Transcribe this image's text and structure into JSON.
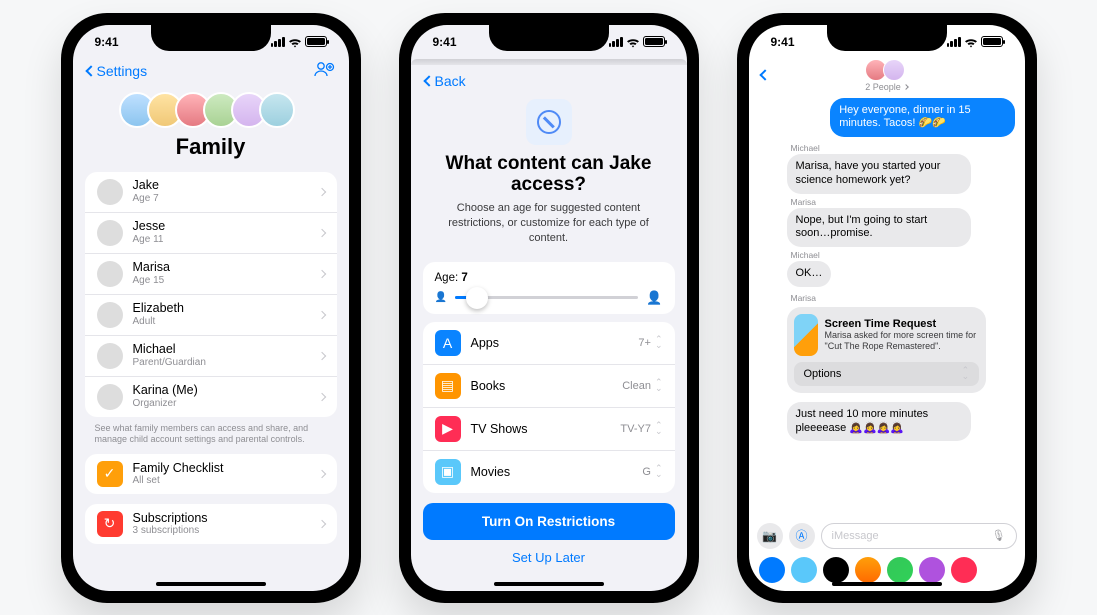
{
  "status": {
    "time": "9:41"
  },
  "phone1": {
    "back": "Settings",
    "title": "Family",
    "members": [
      {
        "name": "Jake",
        "sub": "Age 7",
        "av": "c0"
      },
      {
        "name": "Jesse",
        "sub": "Age 11",
        "av": "c1"
      },
      {
        "name": "Marisa",
        "sub": "Age 15",
        "av": "c2"
      },
      {
        "name": "Elizabeth",
        "sub": "Adult",
        "av": "c3"
      },
      {
        "name": "Michael",
        "sub": "Parent/Guardian",
        "av": "c4"
      },
      {
        "name": "Karina (Me)",
        "sub": "Organizer",
        "av": "c2"
      }
    ],
    "note": "See what family members can access and share, and manage child account settings and parental controls.",
    "checklist": {
      "title": "Family Checklist",
      "sub": "All set"
    },
    "subs": {
      "title": "Subscriptions",
      "sub": "3 subscriptions"
    }
  },
  "phone2": {
    "back": "Back",
    "title": "What content can Jake access?",
    "subtitle": "Choose an age for suggested content restrictions, or customize for each type of content.",
    "age_label": "Age:",
    "age_value": "7",
    "slider_pct": 12,
    "rows": [
      {
        "icon": "blue",
        "label": "Apps",
        "value": "7+"
      },
      {
        "icon": "book",
        "label": "Books",
        "value": "Clean"
      },
      {
        "icon": "pink",
        "label": "TV Shows",
        "value": "TV-Y7"
      },
      {
        "icon": "teal",
        "label": "Movies",
        "value": "G"
      }
    ],
    "primary": "Turn On Restrictions",
    "secondary": "Set Up Later"
  },
  "phone3": {
    "people": "2 People",
    "outgoing": "Hey everyone, dinner in 15 minutes. Tacos! 🌮🌮",
    "msgs": [
      {
        "from": "Michael",
        "text": "Marisa, have you started your science homework yet?",
        "av": "c4"
      },
      {
        "from": "Marisa",
        "text": "Nope, but I'm going to start soon…promise.",
        "av": "c2"
      },
      {
        "from": "Michael",
        "text": "OK…",
        "av": "c4"
      }
    ],
    "request": {
      "from": "Marisa",
      "title": "Screen Time Request",
      "sub": "Marisa asked for more screen time for \"Cut The Rope Remastered\".",
      "options": "Options"
    },
    "last": {
      "text": "Just need 10 more minutes pleeeease 🙇‍♀️🙇‍♀️🙇‍♀️🙇‍♀️",
      "av": "c2"
    },
    "placeholder": "iMessage"
  }
}
